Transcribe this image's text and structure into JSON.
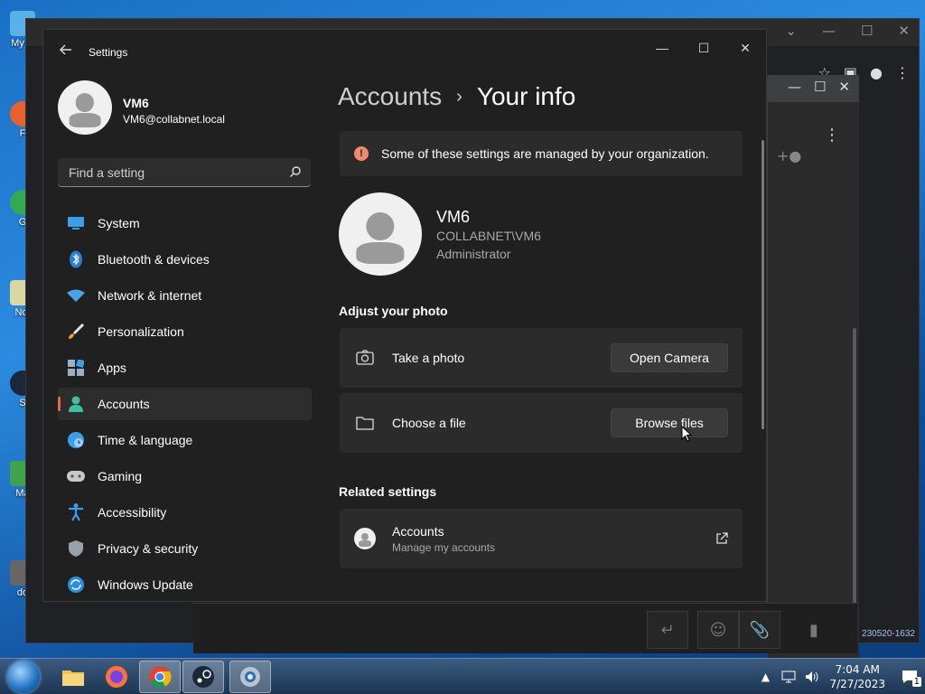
{
  "desktop": {
    "icons": [
      {
        "label": "My C",
        "icon": "computer-icon"
      },
      {
        "label": "F",
        "icon": "firefox-icon"
      },
      {
        "label": "G",
        "icon": "chrome-icon"
      },
      {
        "label": "Not",
        "icon": "notepad-icon"
      },
      {
        "label": "S",
        "icon": "steam-icon"
      },
      {
        "label": "Ma",
        "icon": "app-icon"
      },
      {
        "label": "do",
        "icon": "document-icon"
      }
    ]
  },
  "background_window": {
    "version_text": "230520-1632"
  },
  "settings": {
    "title": "Settings",
    "profile": {
      "name": "VM6",
      "email": "VM6@collabnet.local"
    },
    "search": {
      "placeholder": "Find a setting"
    },
    "nav": [
      {
        "label": "System",
        "icon": "monitor-icon"
      },
      {
        "label": "Bluetooth & devices",
        "icon": "bluetooth-icon"
      },
      {
        "label": "Network & internet",
        "icon": "wifi-icon"
      },
      {
        "label": "Personalization",
        "icon": "brush-icon"
      },
      {
        "label": "Apps",
        "icon": "apps-icon"
      },
      {
        "label": "Accounts",
        "icon": "person-icon",
        "active": true
      },
      {
        "label": "Time & language",
        "icon": "clock-globe-icon"
      },
      {
        "label": "Gaming",
        "icon": "gamepad-icon"
      },
      {
        "label": "Accessibility",
        "icon": "accessibility-icon"
      },
      {
        "label": "Privacy & security",
        "icon": "shield-icon"
      },
      {
        "label": "Windows Update",
        "icon": "update-icon"
      }
    ],
    "breadcrumb": {
      "parent": "Accounts",
      "separator": "›",
      "current": "Your info"
    },
    "banner_text": "Some of these settings are managed by your organization.",
    "user": {
      "name": "VM6",
      "domain": "COLLABNET\\VM6",
      "role": "Administrator"
    },
    "adjust_photo": {
      "title": "Adjust your photo",
      "take_photo": {
        "label": "Take a photo",
        "button": "Open Camera"
      },
      "choose_file": {
        "label": "Choose a file",
        "button": "Browse files"
      }
    },
    "related": {
      "title": "Related settings",
      "accounts": {
        "label": "Accounts",
        "sublabel": "Manage my accounts"
      }
    }
  },
  "taskbar": {
    "time": "7:04 AM",
    "date": "7/27/2023",
    "notification_count": "1",
    "apps": [
      "explorer-icon",
      "firefox-icon",
      "chrome-icon",
      "steam-icon",
      "settings-icon"
    ]
  },
  "colors": {
    "accent": "#e36b4a",
    "window_bg": "#202020",
    "card_bg": "#2b2b2b",
    "info_icon": "#f08a6e"
  }
}
